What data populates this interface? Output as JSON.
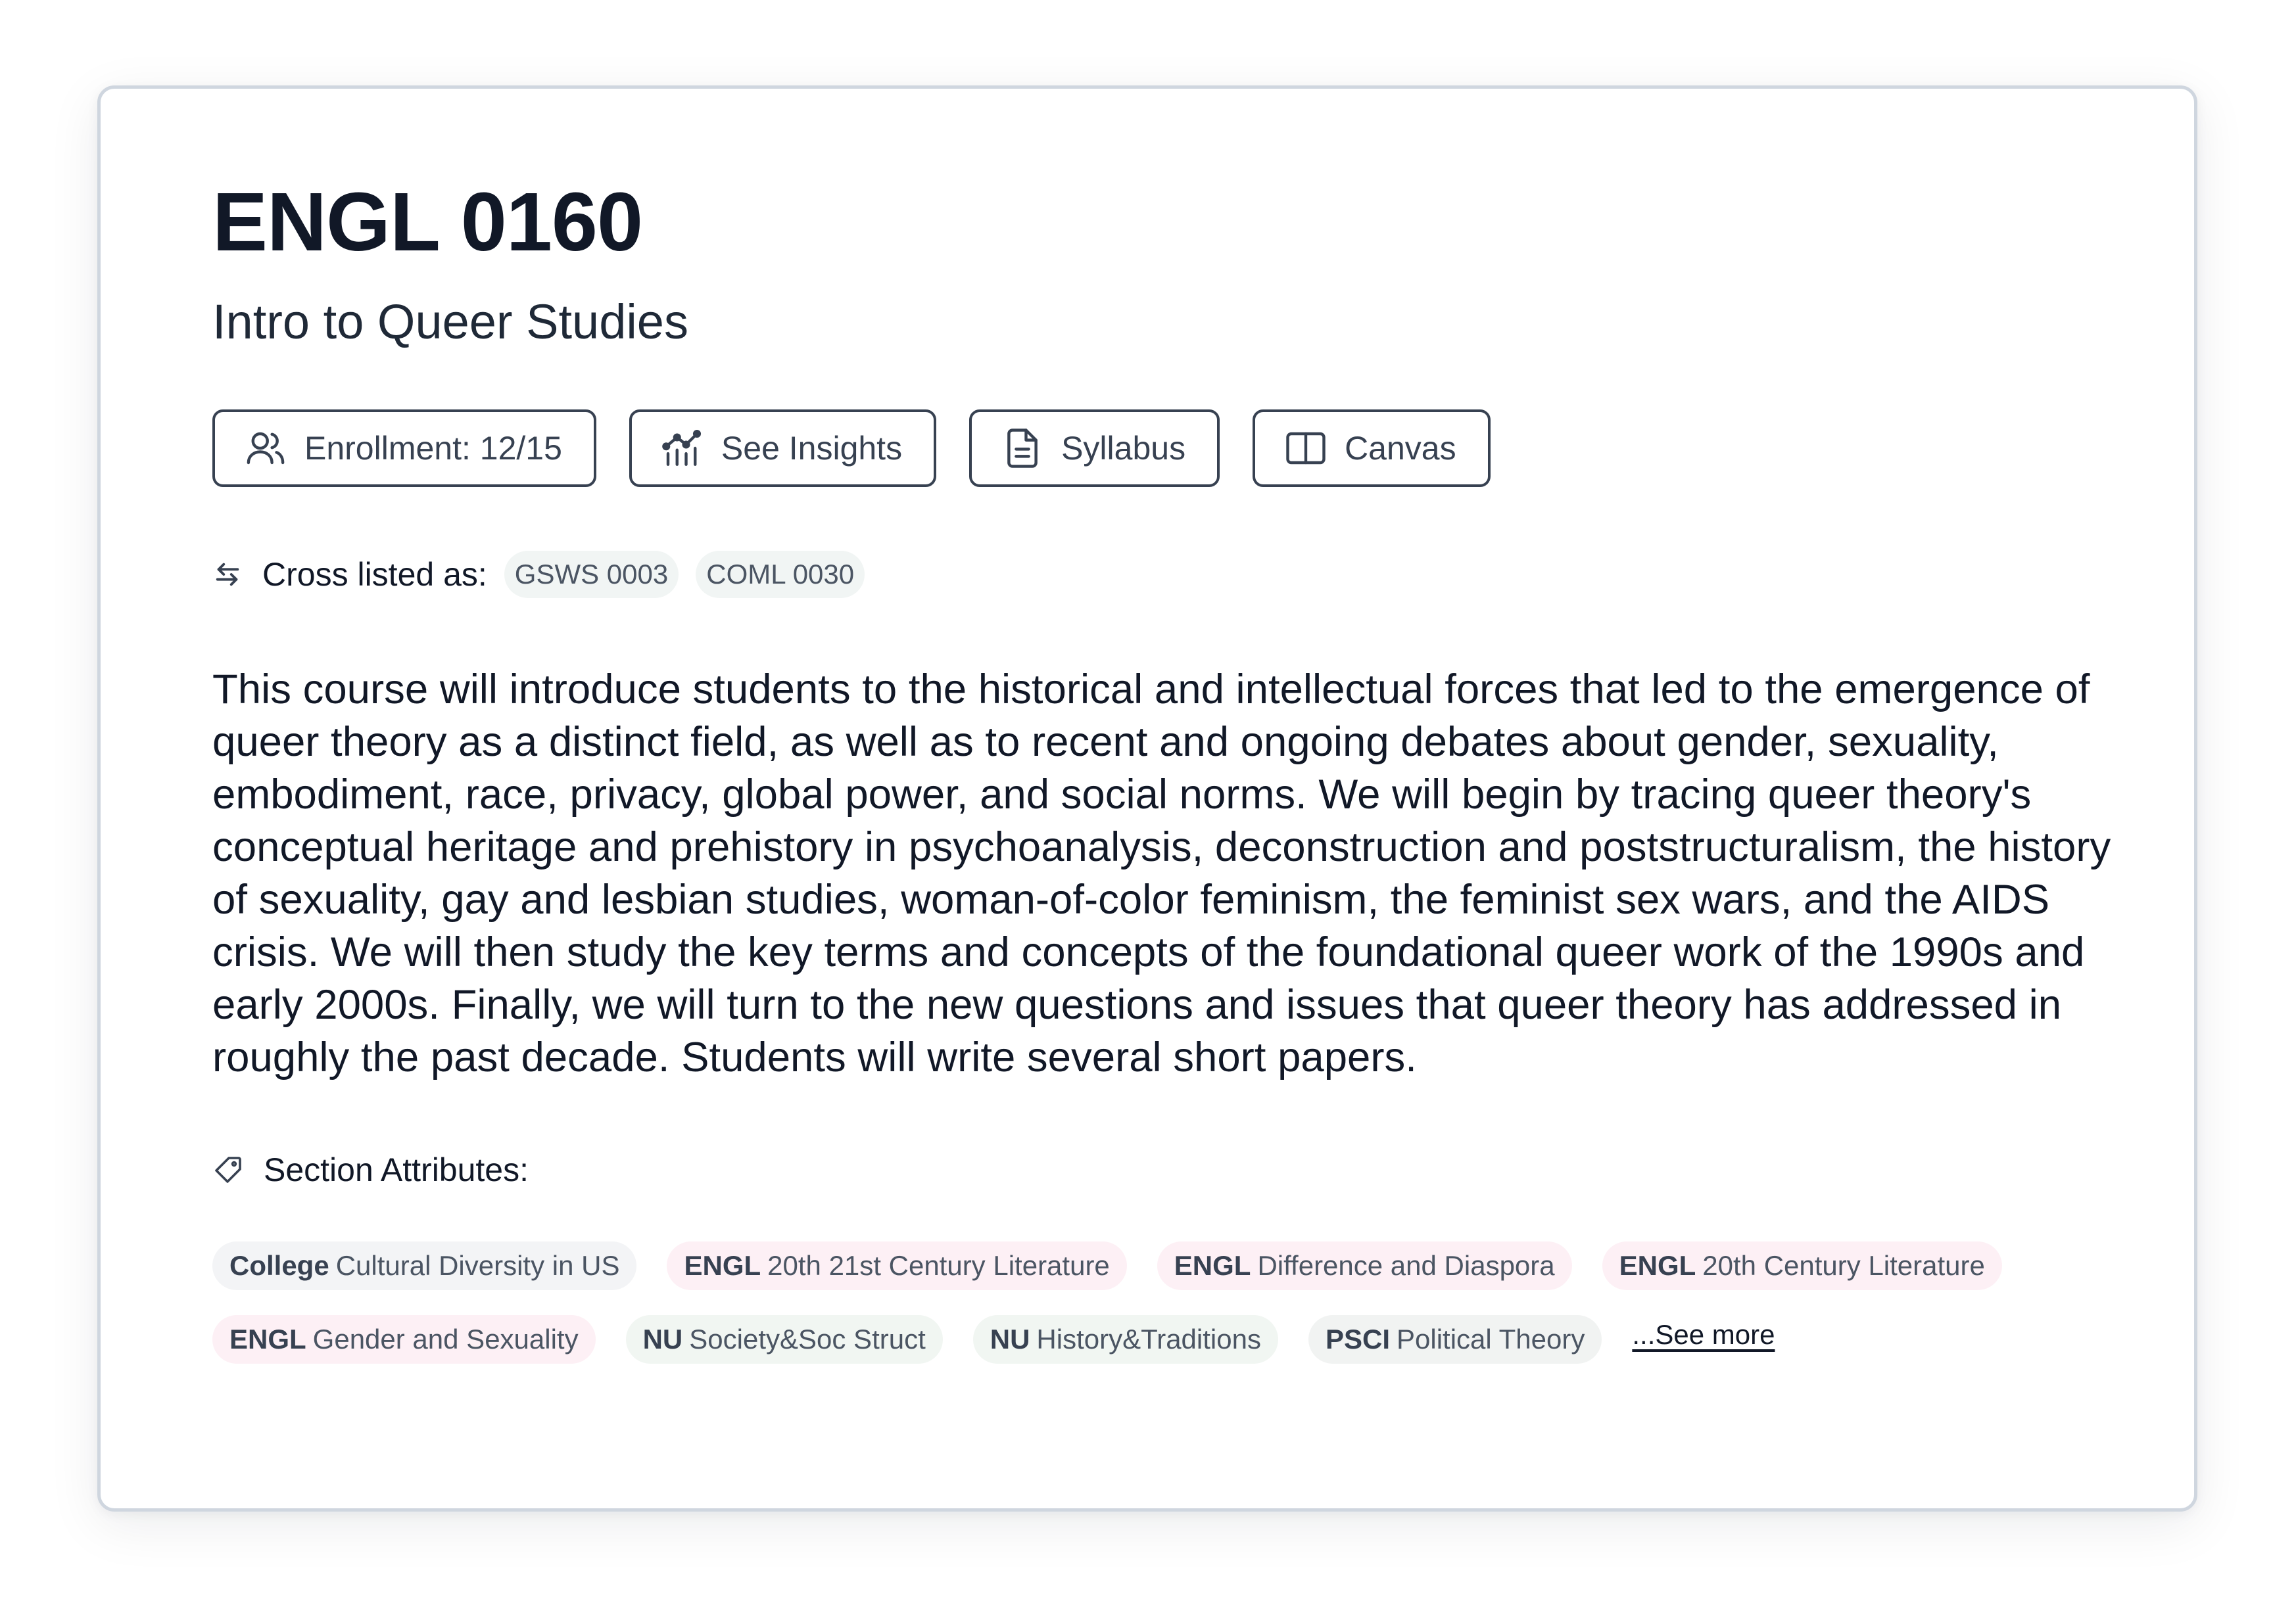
{
  "course": {
    "code": "ENGL 0160",
    "title": "Intro to Queer Studies"
  },
  "actions": {
    "enrollment": "Enrollment: 12/15",
    "insights": "See Insights",
    "syllabus": "Syllabus",
    "canvas": "Canvas"
  },
  "cross_listed": {
    "label": "Cross listed as:",
    "courses": [
      "GSWS 0003",
      "COML 0030"
    ]
  },
  "description": "This course will introduce students to the historical and intellectual forces that led to the emergence of queer theory as a distinct field, as well as to recent and ongoing debates about gender, sexuality, embodiment, race, privacy, global power, and social norms. We will begin by tracing queer theory's conceptual heritage and prehistory in psychoanalysis, deconstruction and poststructuralism, the history of sexuality, gay and lesbian studies, woman-of-color feminism, the feminist sex wars, and the AIDS crisis. We will then study the key terms and concepts of the foundational queer work of the 1990s and early 2000s. Finally, we will turn to the new questions and issues that queer theory has addressed in roughly the past decade. Students will write several short papers.",
  "attributes": {
    "label": "Section Attributes:",
    "tags": [
      {
        "prefix": "College",
        "name": "Cultural Diversity in US",
        "color": "#f3f4f6"
      },
      {
        "prefix": "ENGL",
        "name": "20th 21st Century Literature",
        "color": "#fdf0f5"
      },
      {
        "prefix": "ENGL",
        "name": "Difference and Diaspora",
        "color": "#fdf0f5"
      },
      {
        "prefix": "ENGL",
        "name": "20th Century Literature",
        "color": "#fdf0f5"
      },
      {
        "prefix": "ENGL",
        "name": "Gender and Sexuality",
        "color": "#fdf0f5"
      },
      {
        "prefix": "NU",
        "name": "Society&Soc Struct",
        "color": "#f1f6f2"
      },
      {
        "prefix": "NU",
        "name": "History&Traditions",
        "color": "#f1f6f2"
      },
      {
        "prefix": "PSCI",
        "name": "Political Theory",
        "color": "#f1f3f2"
      }
    ],
    "see_more": "...See more"
  },
  "icons": {
    "enrollment": "users-icon",
    "insights": "insights-chart-icon",
    "syllabus": "document-icon",
    "canvas": "book-open-icon",
    "cross_listed": "arrows-swap-icon",
    "attributes": "tag-icon"
  }
}
